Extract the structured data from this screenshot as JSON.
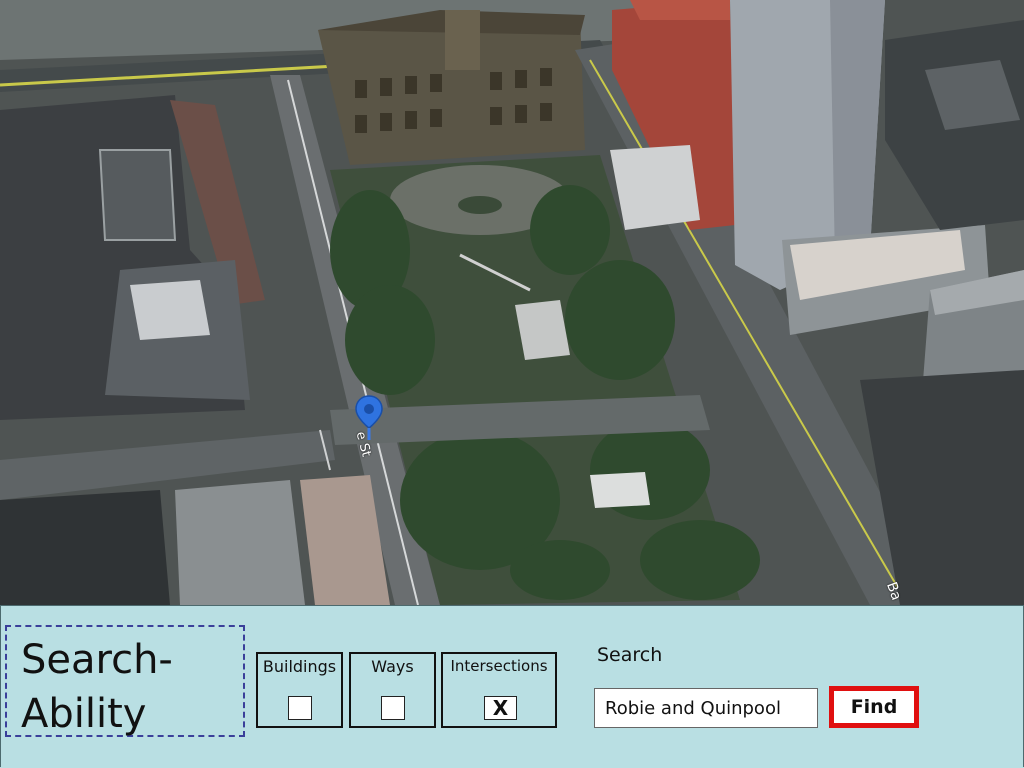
{
  "map": {
    "street_label": "e St",
    "street_label_2": "Ba"
  },
  "panel": {
    "title": "Search-Ability",
    "filters": [
      {
        "label": "Buildings",
        "checked": false,
        "mark": ""
      },
      {
        "label": "Ways",
        "checked": false,
        "mark": ""
      },
      {
        "label": "Intersections",
        "checked": true,
        "mark": "X"
      }
    ],
    "search": {
      "label": "Search",
      "value": "Robie and Quinpool"
    },
    "find_label": "Find"
  },
  "colors": {
    "panel_bg": "#b9dfe3",
    "title_border": "#3a3f9a",
    "find_border": "#e01010",
    "marker": "#2f73e0"
  }
}
